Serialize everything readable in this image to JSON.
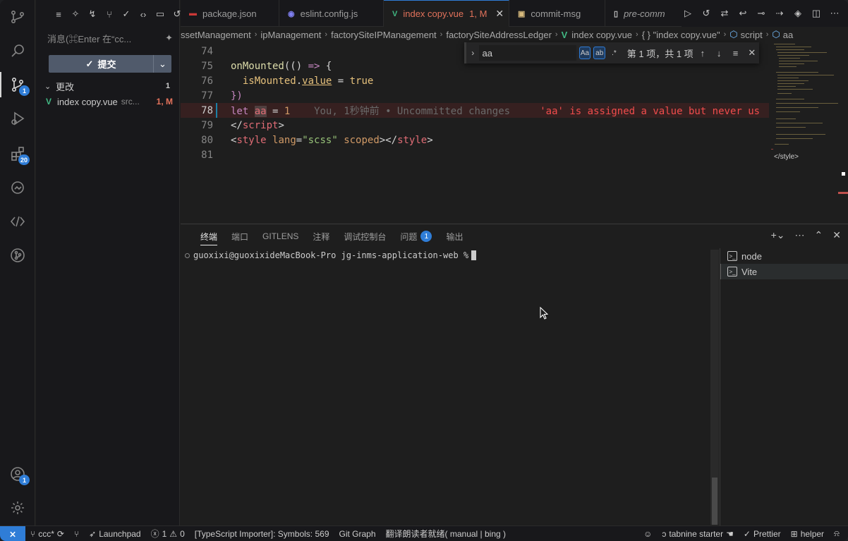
{
  "activity": {
    "scm_badge": "1",
    "extensions_badge": "20",
    "account_badge": "1"
  },
  "sidebar": {
    "toolbar_icons": [
      "list-icon",
      "sparkle-icon",
      "branch-arrow-icon",
      "merge-icon",
      "check-icon",
      "code-icon",
      "comment-icon",
      "history-icon"
    ],
    "message_placeholder": "消息(⌘Enter 在“cc...",
    "commit_label": "提交",
    "changes_label": "更改",
    "changes_count": "1",
    "change_file": "index copy.vue",
    "change_path": "src...",
    "change_status": "1, M"
  },
  "tabs": [
    {
      "label": "package.json",
      "icon": "npm-icon",
      "active": false
    },
    {
      "label": "eslint.config.js",
      "icon": "eslint-icon",
      "active": false
    },
    {
      "label": "index copy.vue",
      "status": "1, M",
      "icon": "vue-icon",
      "active": true
    },
    {
      "label": "commit-msg",
      "icon": "terminal-icon",
      "active": false
    },
    {
      "label": "pre-comm",
      "icon": "file-icon",
      "active": false
    }
  ],
  "breadcrumb": [
    "ssetManagement",
    "ipManagement",
    "factorySiteIPManagement",
    "factorySiteAddressLedger",
    "index copy.vue",
    "{ } \"index copy.vue\"",
    "script",
    "aa"
  ],
  "editor": {
    "lines": [
      {
        "n": "74"
      },
      {
        "n": "75"
      },
      {
        "n": "76"
      },
      {
        "n": "77"
      },
      {
        "n": "78"
      },
      {
        "n": "79"
      },
      {
        "n": "80"
      },
      {
        "n": "81"
      }
    ],
    "blame": "You, 1秒钟前 • Uncommitted changes",
    "diagnostic": "'aa' is assigned a value but never us",
    "minimap_end": "</style>"
  },
  "find": {
    "query": "aa",
    "match_case": "Aa",
    "whole_word": "ab",
    "regex": ".*",
    "result": "第 1 项，共 1 项"
  },
  "panel": {
    "tabs": [
      "终端",
      "端口",
      "GITLENS",
      "注释",
      "调试控制台",
      "问题",
      "输出"
    ],
    "problems_badge": "1",
    "prompt": "guoxixi@guoxixideMacBook-Pro jg-inms-application-web %",
    "terminals": [
      "node",
      "Vite"
    ]
  },
  "status": {
    "branch": "ccc*",
    "launchpad": "Launchpad",
    "errors": "1",
    "warnings": "0",
    "ts_importer": "[TypeScript Importer]: Symbols: 569",
    "git_graph": "Git Graph",
    "translator": "翻译朗读者就绪( manual | bing )",
    "tabnine": "tabnine starter",
    "prettier": "Prettier",
    "helper": "helper"
  },
  "colors": {
    "accent": "#2f7dd7",
    "modified": "#e2725b",
    "vue": "#41b883"
  }
}
